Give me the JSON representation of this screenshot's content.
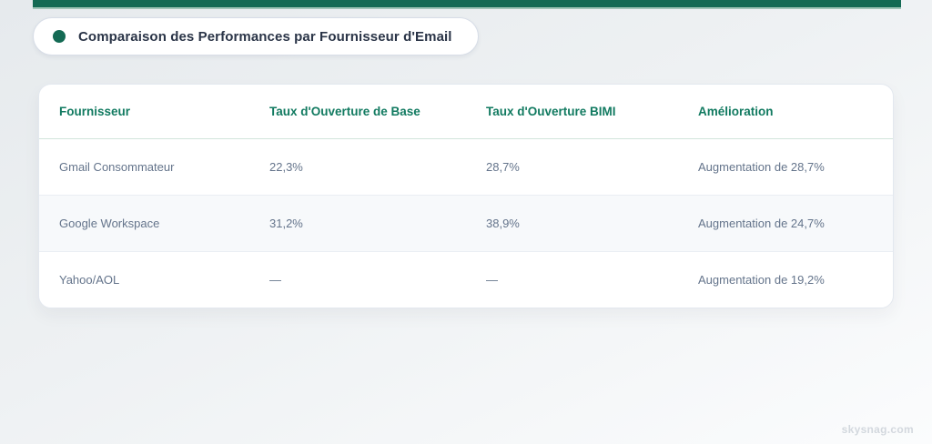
{
  "theme": {
    "accent": "#146a54",
    "accent_soft": "#a0c5b8",
    "header_text": "#117a60",
    "title_text": "#2a3447",
    "provider_text": "#273142",
    "value_text": "#64748b",
    "row_alt_bg": "#f7f9fb",
    "watermark_text": "#d3d8de"
  },
  "header_badge": {
    "label": "Comparaison des Performances par Fournisseur d'Email"
  },
  "table": {
    "headers": [
      "Fournisseur",
      "Taux d'Ouverture de Base",
      "Taux d'Ouverture BIMI",
      "Amélioration"
    ],
    "rows": [
      {
        "provider": "Gmail Consommateur",
        "base": "22,3%",
        "bimi": "28,7%",
        "improvement": "Augmentation de 28,7%"
      },
      {
        "provider": "Google Workspace",
        "base": "31,2%",
        "bimi": "38,9%",
        "improvement": "Augmentation de 24,7%"
      },
      {
        "provider": "Yahoo/AOL",
        "base": "—",
        "bimi": "—",
        "improvement": "Augmentation de 19,2%"
      }
    ]
  },
  "watermark": {
    "text": "skysnag.com"
  },
  "chart_data": {
    "type": "table",
    "title": "Comparaison des Performances par Fournisseur d'Email",
    "columns": [
      "Fournisseur",
      "Taux d'Ouverture de Base",
      "Taux d'Ouverture BIMI",
      "Amélioration"
    ],
    "rows": [
      [
        "Gmail Consommateur",
        "22,3%",
        "28,7%",
        "Augmentation de 28,7%"
      ],
      [
        "Google Workspace",
        "31,2%",
        "38,9%",
        "Augmentation de 24,7%"
      ],
      [
        "Yahoo/AOL",
        "—",
        "—",
        "Augmentation de 19,2%"
      ]
    ],
    "numeric": {
      "base_open_rate_pct": [
        22.3,
        31.2,
        null
      ],
      "bimi_open_rate_pct": [
        28.7,
        38.9,
        null
      ],
      "improvement_pct": [
        28.7,
        24.7,
        19.2
      ]
    }
  }
}
